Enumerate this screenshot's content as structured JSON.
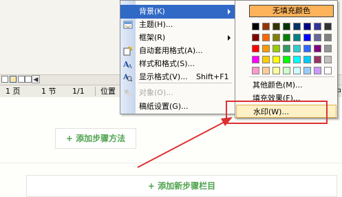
{
  "status_bar": {
    "page": "1 页",
    "section": "1 节",
    "pages_of": "1/1",
    "position_label": "位置",
    "overflow_char": "中"
  },
  "content": {
    "add_step_method": "+ 添加步骤方法",
    "add_new_step_bar": "+ 添加新步骤栏目"
  },
  "format_menu": {
    "items": [
      {
        "label": "背景(K)",
        "has_submenu": true,
        "selected": true,
        "icon": "none"
      },
      {
        "label": "主题(H)...",
        "icon": "theme-icon"
      },
      {
        "label": "框架(R)",
        "has_submenu": true,
        "icon": "none"
      },
      {
        "label": "自动套用格式(A)...",
        "icon": "autoformat-icon"
      },
      {
        "label": "样式和格式(S)...",
        "icon": "styles-icon"
      },
      {
        "label": "显示格式(V)...",
        "shortcut": "Shift+F1",
        "icon": "reveal-format-icon"
      },
      {
        "label": "对象(O)...",
        "disabled": true,
        "icon": "object-icon"
      },
      {
        "label": "稿纸设置(G)...",
        "icon": "none"
      }
    ]
  },
  "background_submenu": {
    "no_fill_label": "无填充颜色",
    "more_colors_label": "其他颜色(M)...",
    "fill_effects_label": "填充效果(F)...",
    "watermark_label": "水印(W)...",
    "palette": [
      [
        "#000000",
        "#993300",
        "#333300",
        "#003300",
        "#003366",
        "#000080",
        "#333399",
        "#333333"
      ],
      [
        "#800000",
        "#ff6600",
        "#808000",
        "#008000",
        "#008080",
        "#0000ff",
        "#666699",
        "#808080"
      ],
      [
        "#ff0000",
        "#ff9900",
        "#99cc00",
        "#339966",
        "#33cccc",
        "#3366ff",
        "#800080",
        "#969696"
      ],
      [
        "#ff00ff",
        "#ffcc00",
        "#ffff00",
        "#00ff00",
        "#00ffff",
        "#00ccff",
        "#993366",
        "#c0c0c0"
      ],
      [
        "#ff99cc",
        "#ffcc99",
        "#ffff99",
        "#ccffcc",
        "#ccffff",
        "#99ccff",
        "#cc99ff",
        "#ffffff"
      ]
    ]
  },
  "colors": {
    "menu_highlight": "#3169c6",
    "no_fill_button": "#fcb35a",
    "annotation_red": "#dc3030",
    "accent_green": "#4fa34f",
    "watermark_hover": "#fff0c6"
  }
}
